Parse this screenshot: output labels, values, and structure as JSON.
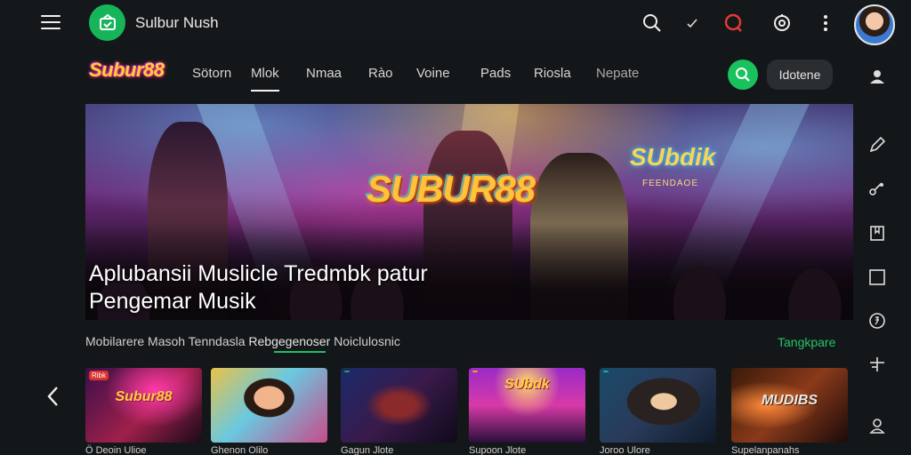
{
  "topbar": {
    "app_title": "Sulbur Nush",
    "icons": [
      "menu-icon",
      "app-logo-icon",
      "search-icon",
      "check-icon",
      "record-icon",
      "settings-icon",
      "more-vert-icon"
    ],
    "accent_color": "#17b55a"
  },
  "nav": {
    "brand": "Subur88",
    "tabs": [
      {
        "label": "Sötorn",
        "active": false
      },
      {
        "label": "Mlok",
        "active": true
      },
      {
        "label": "Nmaa",
        "active": false
      },
      {
        "label": "Rào",
        "active": false
      },
      {
        "label": "Voine",
        "active": false
      },
      {
        "label": "Pads",
        "active": false
      },
      {
        "label": "Riosla",
        "active": false
      },
      {
        "label": "Nepate",
        "active": false
      }
    ],
    "action_button": "Idotene"
  },
  "hero": {
    "logo_text": "SUBUR88",
    "sign_text": "SUbdik",
    "sign_sub": "FEENDAOE",
    "caption_line1": "Aplubansii Muslicle Tredmbk patur",
    "caption_line2": "Pengemar Musik"
  },
  "trending": {
    "text_prefix": "Mobilarere Masoh Tenndasla",
    "text_highlight": "Rebgegenoser",
    "text_suffix": "Noiclulosnic",
    "see_all": "Tangkpare"
  },
  "thumbnails": [
    {
      "tag": "Ribk",
      "title": "Subur88",
      "caption": "Ö Deoin Ulioe"
    },
    {
      "tag": "",
      "title": "",
      "caption": "Ghenon Olilo"
    },
    {
      "tag": "",
      "title": "",
      "caption": "Gagun Jlote"
    },
    {
      "tag": "",
      "title": "SUbdk",
      "caption": "Supoon Jlote"
    },
    {
      "tag": "",
      "title": "",
      "caption": "Joroo Ulore"
    },
    {
      "tag": "",
      "title": "MUDIBS",
      "caption": "Supelanpanahs"
    }
  ],
  "right_rail_icons": [
    "profile-sync-icon",
    "edit-icon",
    "share-icon",
    "book-icon",
    "square-icon",
    "currency-icon",
    "split-icon",
    "user-icon"
  ]
}
